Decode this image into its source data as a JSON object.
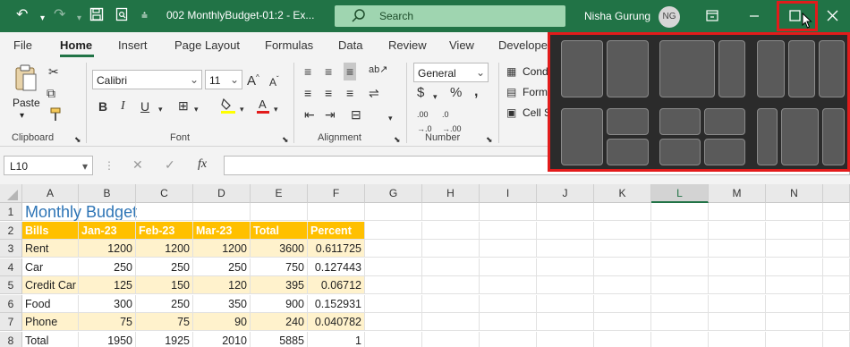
{
  "titlebar": {
    "file_name": "002 MonthlyBudget-01:2  -  Ex...",
    "search_placeholder": "Search",
    "user_name": "Nisha Gurung",
    "user_initials": "NG"
  },
  "tabs": [
    "File",
    "Home",
    "Insert",
    "Page Layout",
    "Formulas",
    "Data",
    "Review",
    "View",
    "Develope"
  ],
  "ribbon": {
    "clipboard": {
      "paste_label": "Paste",
      "group_label": "Clipboard"
    },
    "font": {
      "family": "Calibri",
      "size": "11",
      "group_label": "Font"
    },
    "alignment": {
      "group_label": "Alignment"
    },
    "number": {
      "format": "General",
      "group_label": "Number"
    },
    "styles": {
      "conditional_label": "Cond",
      "format_label": "Form",
      "cell_label": "Cell S"
    }
  },
  "formula_bar": {
    "name_box": "L10",
    "fx_label": "fx",
    "value": ""
  },
  "columns": [
    "A",
    "B",
    "C",
    "D",
    "E",
    "F",
    "G",
    "H",
    "I",
    "J",
    "K",
    "L",
    "M",
    "N"
  ],
  "selected_column": "L",
  "rows": [
    "1",
    "2",
    "3",
    "4",
    "5",
    "6",
    "7",
    "8"
  ],
  "sheet": {
    "title": "Monthly Budget",
    "headers": [
      "Bills",
      "Jan-23",
      "Feb-23",
      "Mar-23",
      "Total",
      "Percent"
    ],
    "data": [
      [
        "Rent",
        "1200",
        "1200",
        "1200",
        "3600",
        "0.611725"
      ],
      [
        "Car",
        "250",
        "250",
        "250",
        "750",
        "0.127443"
      ],
      [
        "Credit Car",
        "125",
        "150",
        "120",
        "395",
        "0.06712"
      ],
      [
        "Food",
        "300",
        "250",
        "350",
        "900",
        "0.152931"
      ],
      [
        "Phone",
        "75",
        "75",
        "90",
        "240",
        "0.040782"
      ],
      [
        "Total",
        "1950",
        "1925",
        "2010",
        "5885",
        "1"
      ]
    ]
  },
  "colors": {
    "accent": "#217346",
    "header_fill": "#ffc000",
    "band_fill": "#fff2cc",
    "title_color": "#2e75b6",
    "highlight": "#e21b1b"
  }
}
